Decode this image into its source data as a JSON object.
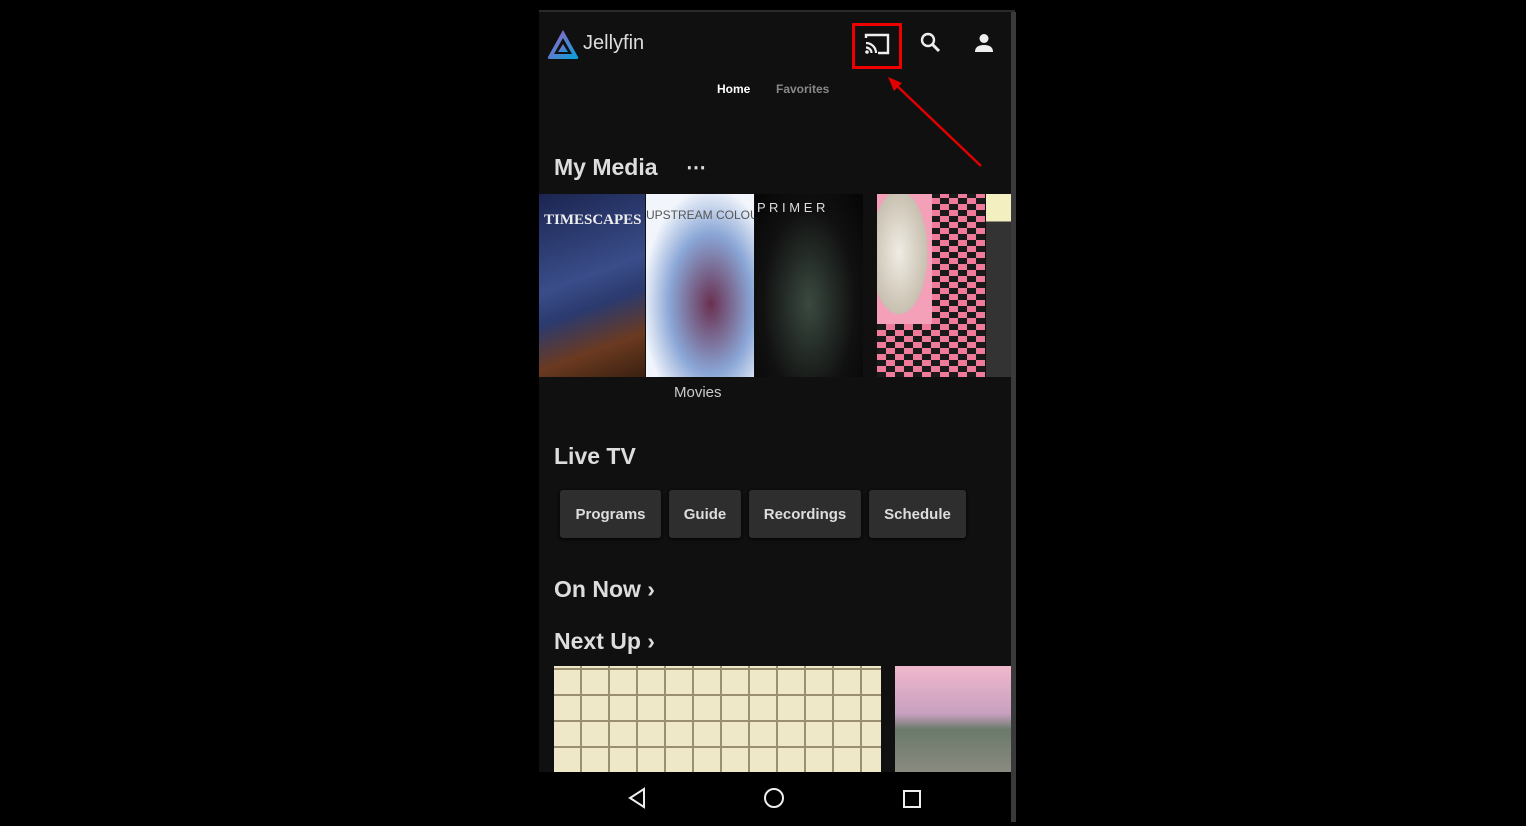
{
  "app": {
    "name": "Jellyfin"
  },
  "header": {
    "icons": [
      "cast-icon",
      "search-icon",
      "user-icon"
    ]
  },
  "tabs": [
    {
      "label": "Home",
      "active": true
    },
    {
      "label": "Favorites",
      "active": false
    }
  ],
  "my_media": {
    "title": "My Media",
    "more": "⋯",
    "library_label": "Movies",
    "posters": [
      {
        "title": "TIMESCAPES"
      },
      {
        "title": "UPSTREAM COLOUR"
      },
      {
        "title": "P R I M E R"
      },
      {
        "title": ""
      },
      {
        "title": ""
      }
    ]
  },
  "live_tv": {
    "title": "Live TV",
    "buttons": [
      "Programs",
      "Guide",
      "Recordings",
      "Schedule"
    ]
  },
  "on_now": {
    "title": "On Now ›"
  },
  "next_up": {
    "title": "Next Up ›"
  },
  "annotation": {
    "color": "#e00000"
  }
}
